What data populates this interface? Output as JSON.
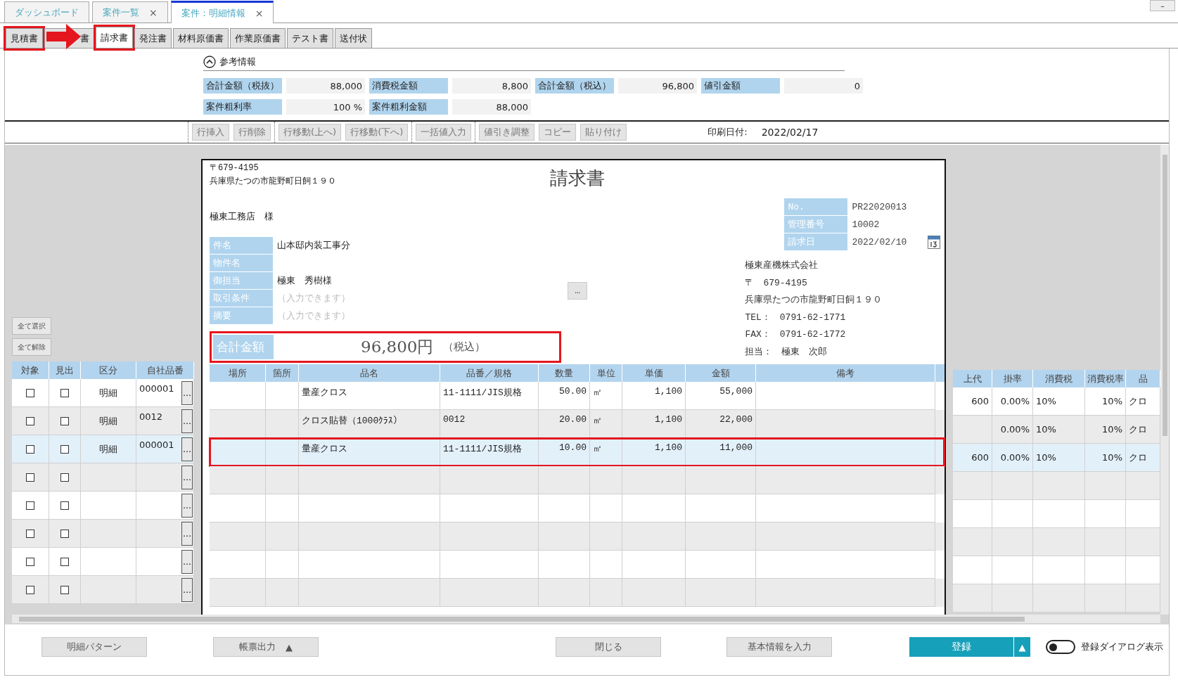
{
  "window_tabs": [
    {
      "label": "ダッシュボード",
      "selected": false
    },
    {
      "label": "案件一覧",
      "close": "×",
      "selected": false
    },
    {
      "label": "案件：明細情報",
      "close": "×",
      "selected": true
    }
  ],
  "minimize": "–",
  "doc_tabs": [
    {
      "label": "見積書",
      "selected": false,
      "highlighted": true
    },
    {
      "label": "書",
      "selected": false,
      "highlighted": false
    },
    {
      "label": "請求書",
      "selected": true,
      "highlighted": true
    },
    {
      "label": "発注書",
      "selected": false,
      "highlighted": false
    },
    {
      "label": "材料原価書",
      "selected": false,
      "highlighted": false
    },
    {
      "label": "作業原価書",
      "selected": false,
      "highlighted": false
    },
    {
      "label": "テスト書",
      "selected": false,
      "highlighted": false
    },
    {
      "label": "送付状",
      "selected": false,
      "highlighted": false
    }
  ],
  "reference": {
    "title": "参考情報",
    "expanded": true,
    "fields": [
      {
        "label": "合計金額（税抜）",
        "value": "88,000"
      },
      {
        "label": "消費税金額",
        "value": "8,800"
      },
      {
        "label": "合計金額（税込）",
        "value": "96,800"
      },
      {
        "label": "値引金額",
        "value": "0"
      },
      {
        "label": "案件粗利率",
        "value": "100 %"
      },
      {
        "label": "案件粗利金額",
        "value": "88,000"
      }
    ]
  },
  "toolbar": [
    [
      "行挿入",
      "行削除"
    ],
    [
      "行移動(上へ)",
      "行移動(下へ)"
    ],
    [
      "一括値入力"
    ],
    [
      "値引き調整",
      "コピー",
      "貼り付け"
    ]
  ],
  "print_date": {
    "label": "印刷日付:",
    "value": "2022/02/17"
  },
  "select_all": "全て選択",
  "deselect_all": "全て解除",
  "document": {
    "title": "請求書",
    "sender_postal": "〒679-4195",
    "sender_address": "兵庫県たつの市龍野町日飼１９０",
    "customer": "極東工務店　様",
    "fields": [
      {
        "label": "件名",
        "value": "山本邸内装工事分"
      },
      {
        "label": "物件名"
      },
      {
        "label": "御担当",
        "value": "極東　秀樹様"
      },
      {
        "label": "取引条件",
        "placeholder": "（入力できます）"
      },
      {
        "label": "摘要",
        "placeholder": "（入力できます）"
      }
    ],
    "terms_button": "…",
    "meta": [
      {
        "label": "No.",
        "value": "PR22020013"
      },
      {
        "label": "管理番号",
        "value": "10002"
      },
      {
        "label": "請求日",
        "value": "2022/02/10"
      }
    ],
    "company": [
      "極東産機株式会社",
      "〒　679-4195",
      "兵庫県たつの市龍野町日飼１９０",
      "TEL：　0791-62-1771",
      "FAX：　0791-62-1772",
      "担当：　極東　次郎"
    ],
    "total": {
      "label": "合計金額",
      "amount": "96,800円",
      "note": "（税込）",
      "highlighted": true
    }
  },
  "left_columns": [
    "対象",
    "見出",
    "区分",
    "自社品番"
  ],
  "detail_columns": [
    "場所",
    "箇所",
    "品名",
    "品番／規格",
    "数量",
    "単位",
    "単価",
    "金額",
    "備考"
  ],
  "extra_columns": [
    "上代",
    "掛率",
    "消費税",
    "消費税率",
    "品"
  ],
  "rows": [
    {
      "selected": false,
      "highlighted": false,
      "target": false,
      "heading": false,
      "category": "明細",
      "code": "000001",
      "picker": "…",
      "name": "量産クロス",
      "spec": "11-1111/JIS規格",
      "qty": "50.00",
      "unit": "㎡",
      "unit_price": "1,100",
      "amount": "55,000",
      "list_price": "600",
      "rate": "0.00%",
      "tax": "10%",
      "tax_rate": "10%",
      "column_5": "クロ"
    },
    {
      "selected": false,
      "highlighted": false,
      "target": false,
      "heading": false,
      "category": "明細",
      "code": "0012",
      "picker": "…",
      "name": "クロス貼替（1000ｸﾗｽ）",
      "spec": "0012",
      "qty": "20.00",
      "unit": "㎡",
      "unit_price": "1,100",
      "amount": "22,000",
      "rate": "0.00%",
      "tax": "10%",
      "tax_rate": "10%",
      "column_5": "クロ"
    },
    {
      "selected": true,
      "highlighted": true,
      "target": false,
      "heading": false,
      "category": "明細",
      "code": "000001",
      "picker": "…",
      "name": "量産クロス",
      "spec": "11-1111/JIS規格",
      "qty": "10.00",
      "unit": "㎡",
      "unit_price": "1,100",
      "amount": "11,000",
      "list_price": "600",
      "rate": "0.00%",
      "tax": "10%",
      "tax_rate": "10%",
      "column_5": "クロ"
    },
    {
      "selected": false,
      "highlighted": false,
      "target": false,
      "heading": false,
      "picker": "…"
    },
    {
      "selected": false,
      "highlighted": false,
      "target": false,
      "heading": false,
      "picker": "…"
    },
    {
      "selected": false,
      "highlighted": false,
      "target": false,
      "heading": false,
      "picker": "…"
    },
    {
      "selected": false,
      "highlighted": false,
      "target": false,
      "heading": false,
      "picker": "…"
    },
    {
      "selected": false,
      "highlighted": false,
      "target": false,
      "heading": false,
      "picker": "…"
    }
  ],
  "footer": {
    "pattern": "明細パターン",
    "output": "帳票出力",
    "output_caret": "▲",
    "close": "閉じる",
    "basic_info": "基本情報を入力",
    "register": "登録",
    "register_caret": "▲",
    "register_dialog": {
      "label": "登録ダイアログ表示",
      "on": false
    }
  }
}
